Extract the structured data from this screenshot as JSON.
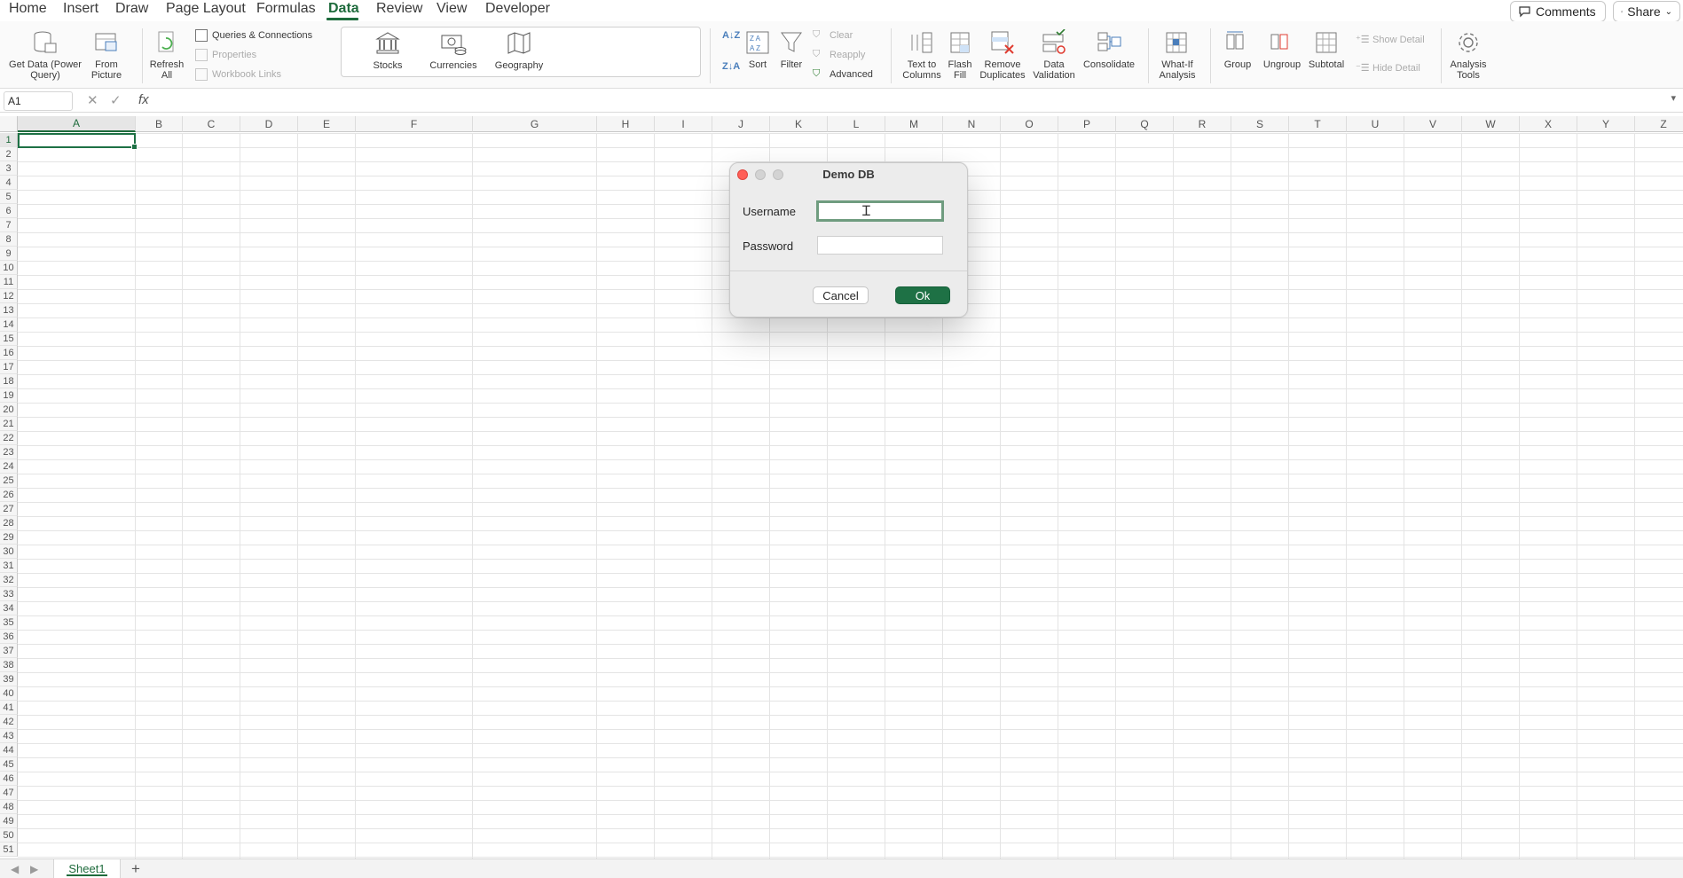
{
  "menu": {
    "tabs": [
      "Home",
      "Insert",
      "Draw",
      "Page Layout",
      "Formulas",
      "Data",
      "Review",
      "View",
      "Developer"
    ],
    "active_tab": "Data",
    "comments_label": "Comments",
    "share_label": "Share"
  },
  "ribbon": {
    "get_data": "Get Data (Power Query)",
    "from_picture": "From Picture",
    "refresh_all": "Refresh All",
    "queries_connections": "Queries & Connections",
    "properties": "Properties",
    "workbook_links": "Workbook Links",
    "stocks": "Stocks",
    "currencies": "Currencies",
    "geography": "Geography",
    "sort": "Sort",
    "filter": "Filter",
    "clear": "Clear",
    "reapply": "Reapply",
    "advanced": "Advanced",
    "text_to_columns": "Text to Columns",
    "flash_fill": "Flash Fill",
    "remove_duplicates": "Remove Duplicates",
    "data_validation": "Data Validation",
    "consolidate": "Consolidate",
    "what_if": "What-If Analysis",
    "group": "Group",
    "ungroup": "Ungroup",
    "subtotal": "Subtotal",
    "show_detail": "Show Detail",
    "hide_detail": "Hide Detail",
    "analysis_tools": "Analysis Tools"
  },
  "formula_bar": {
    "name_box": "A1",
    "fx": "fx",
    "content": ""
  },
  "grid": {
    "columns": [
      "A",
      "B",
      "C",
      "D",
      "E",
      "F",
      "G",
      "H",
      "I",
      "J",
      "K",
      "L",
      "M",
      "N",
      "O",
      "P",
      "Q",
      "R",
      "S",
      "T",
      "U",
      "V",
      "W",
      "X",
      "Y",
      "Z"
    ],
    "rows": 51,
    "selected_cell": "A1"
  },
  "sheets": {
    "tabs": [
      "Sheet1"
    ],
    "add": "+"
  },
  "dialog": {
    "title": "Demo DB",
    "username_label": "Username",
    "password_label": "Password",
    "username_value": "",
    "password_value": "",
    "cancel_label": "Cancel",
    "ok_label": "Ok"
  },
  "colors": {
    "accent": "#1e6b3c",
    "ok_button": "#1e7145",
    "close_traffic": "#ff5f57"
  }
}
